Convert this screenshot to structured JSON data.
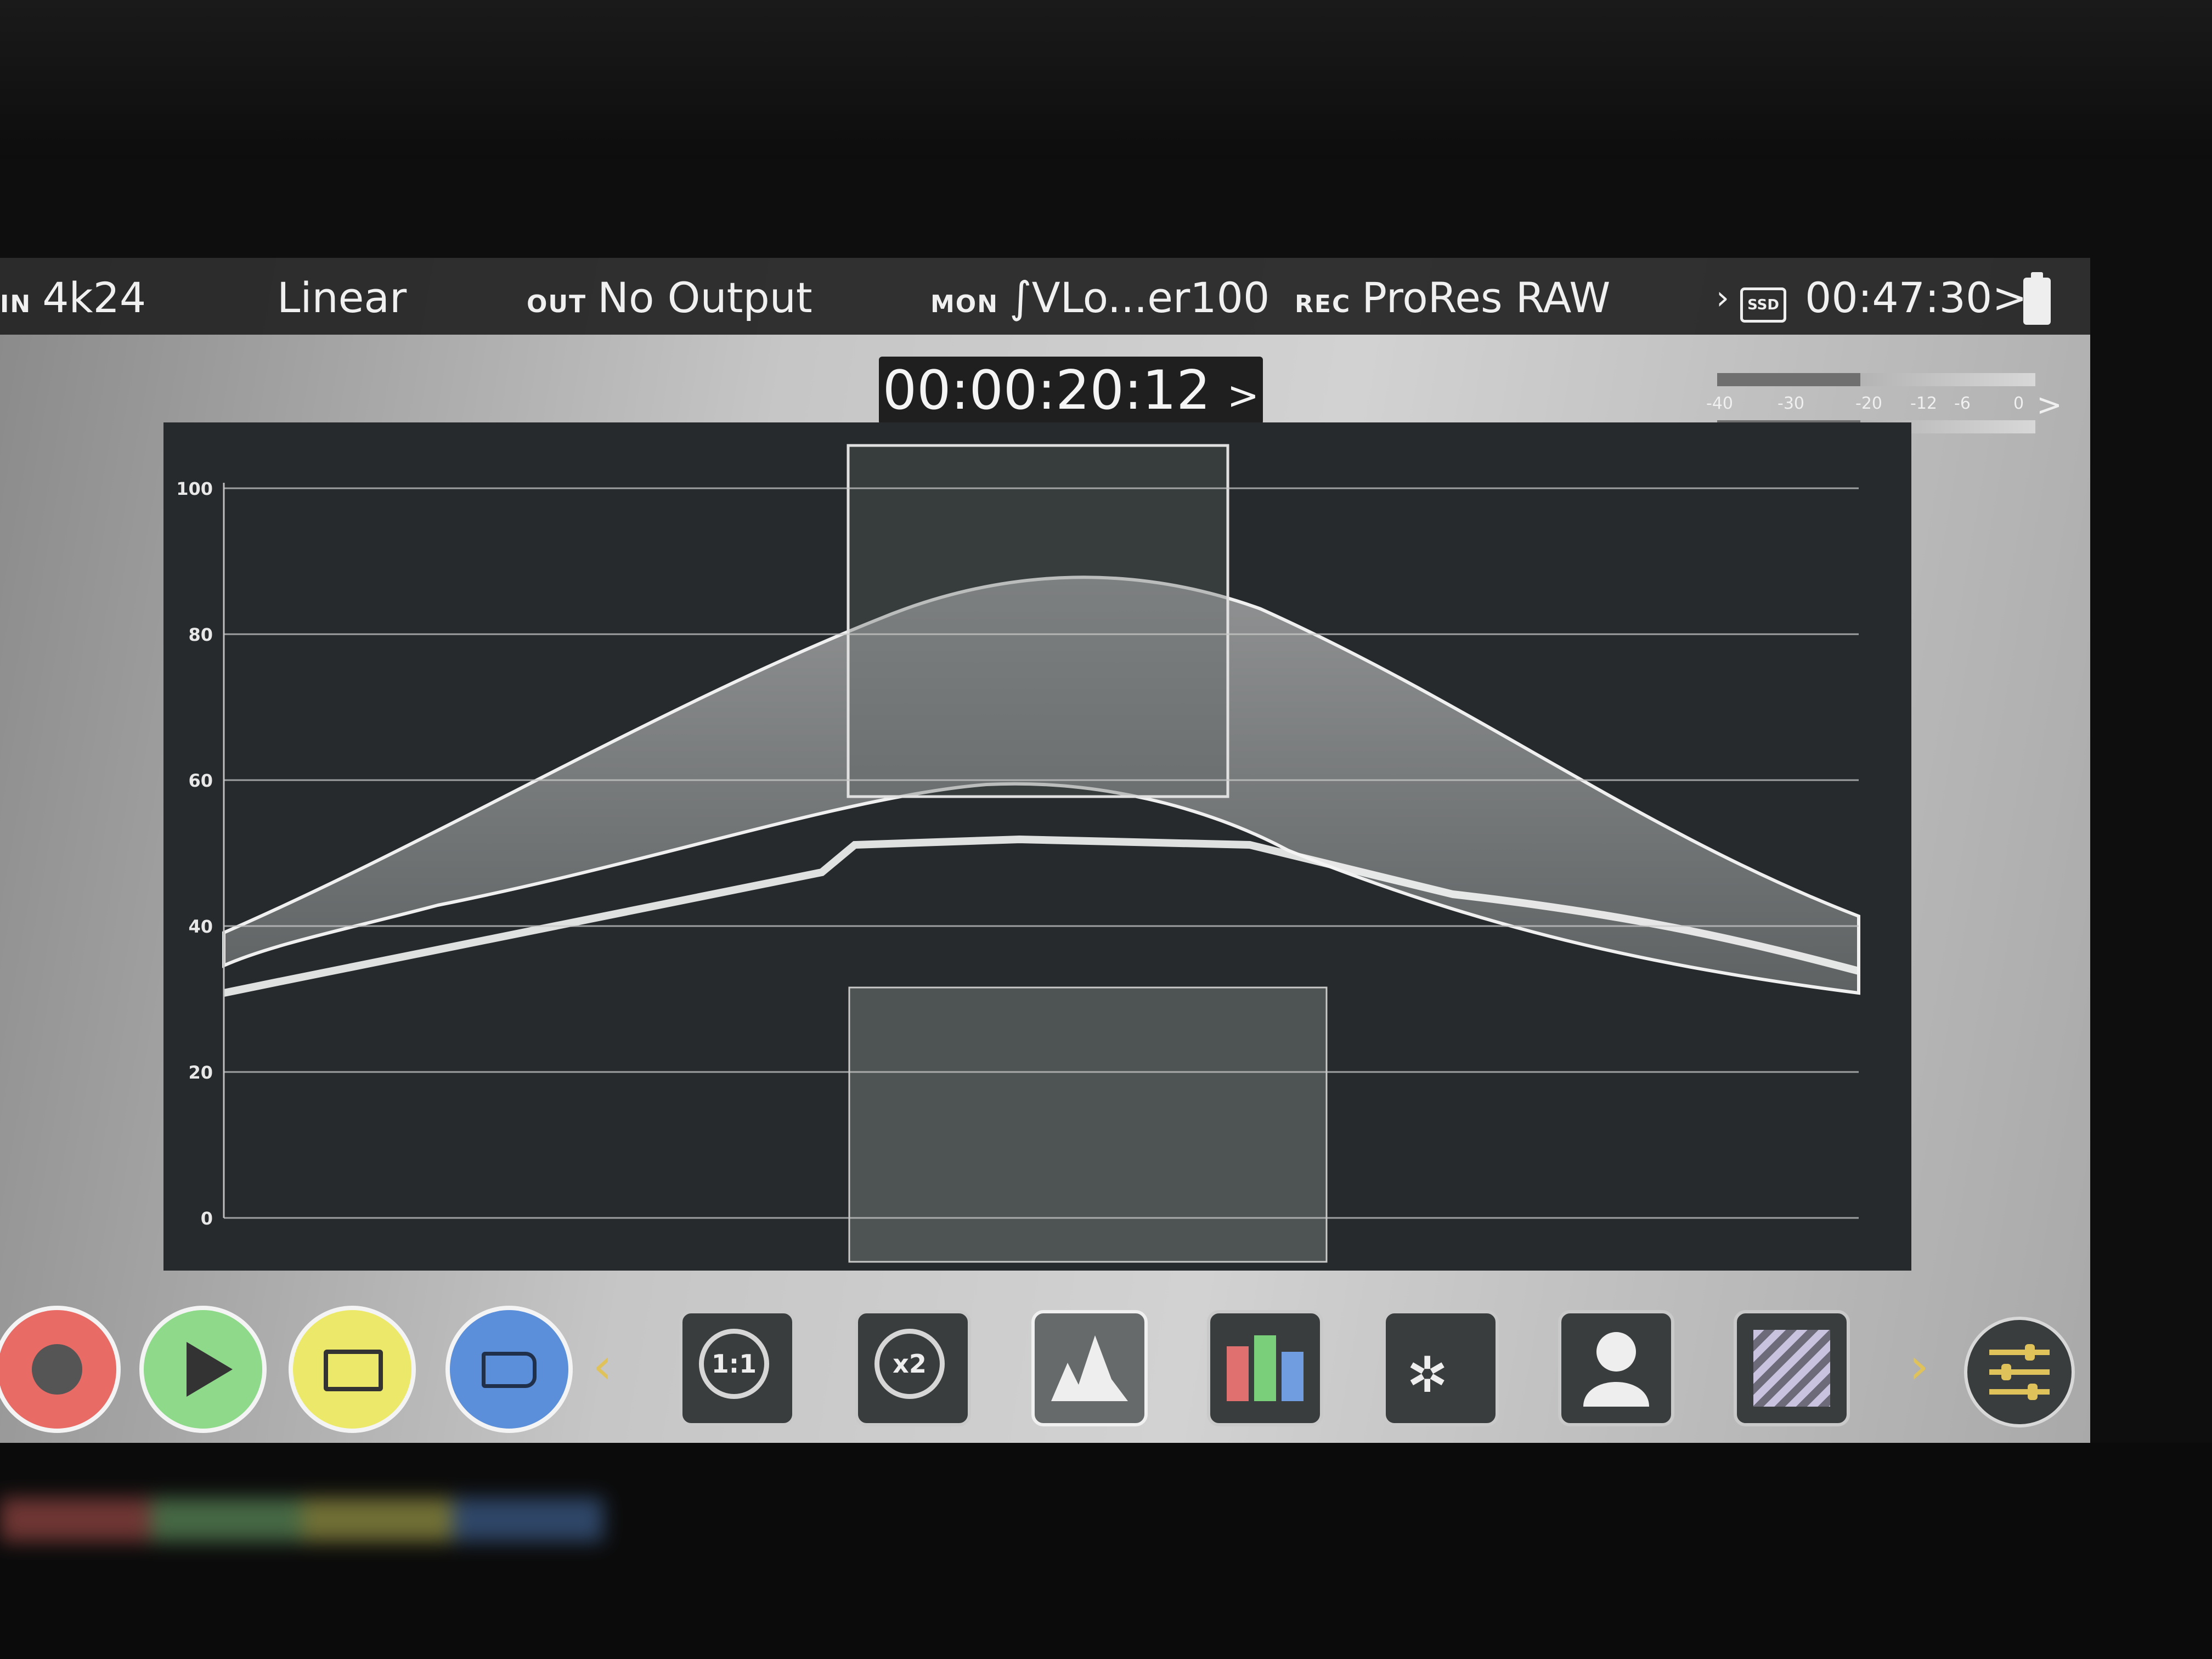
{
  "status": {
    "in_label": "IN",
    "in_value": "4k24",
    "mode": "Linear",
    "out_label": "OUT",
    "out_value": "No Output",
    "mon_label": "MON",
    "mon_value": "VLo...er100",
    "rec_label": "REC",
    "rec_value": "ProRes RAW",
    "ssd_label": "SSD",
    "remaining": "00:47:30",
    "remaining_chevron": ">"
  },
  "timecode": {
    "value": "00:00:20:12",
    "chevron": ">"
  },
  "audio_meter": {
    "ticks": [
      "-40",
      "-30",
      "-20",
      "-12",
      "-6",
      "0"
    ],
    "chevron": ">"
  },
  "waveform": {
    "scale_labels": [
      "100",
      "80",
      "60",
      "40",
      "20",
      "0"
    ],
    "scale_values": [
      100,
      80,
      60,
      40,
      20,
      0
    ]
  },
  "toolbar": {
    "prev_arrow": "‹",
    "next_arrow": "›",
    "zoom1_label": "1:1",
    "zoom2_label": "x2",
    "selected_tool": "waveform"
  },
  "colors": {
    "record": "#e86b66",
    "play": "#8ed98a",
    "monitor": "#ece96a",
    "tag": "#5b8fd9",
    "arrow": "#e0c25a"
  }
}
